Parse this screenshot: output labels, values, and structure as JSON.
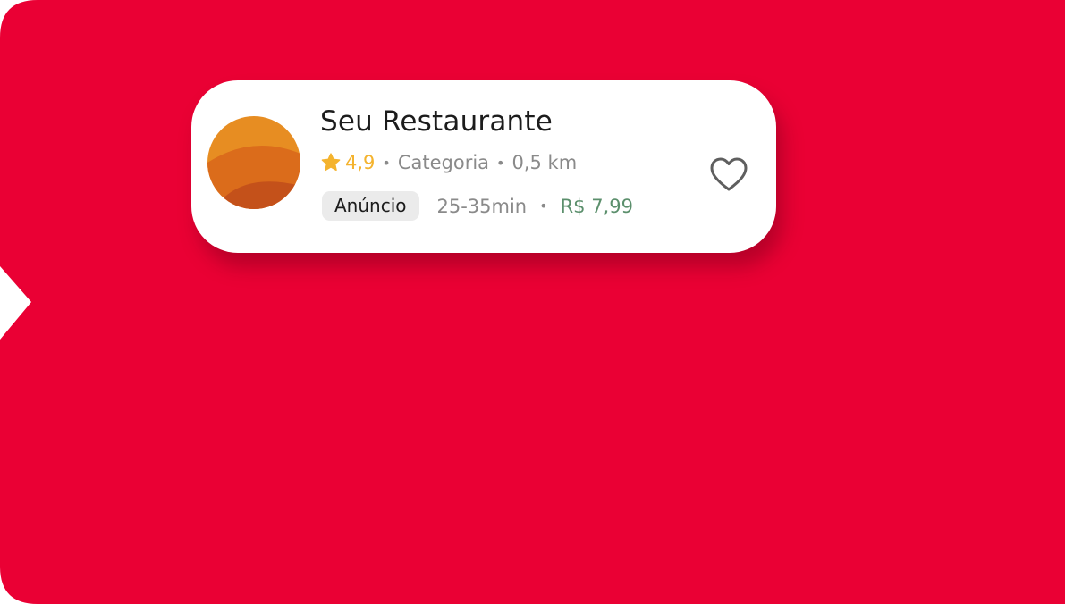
{
  "colors": {
    "banner": "#EA0034",
    "rating": "#F4B32E",
    "fee": "#5B8F6C",
    "logo_top": "#E78D22",
    "logo_mid": "#DB6C1B",
    "logo_bottom": "#C4511A"
  },
  "card": {
    "title": "Seu Restaurante",
    "rating": "4,9",
    "category": "Categoria",
    "distance": "0,5 km",
    "separator": "•",
    "badge": "Anúncio",
    "delivery_time": "25-35min",
    "delivery_fee": "R$ 7,99",
    "icons": {
      "rating": "star-icon",
      "favorite": "heart-outline-icon"
    }
  }
}
